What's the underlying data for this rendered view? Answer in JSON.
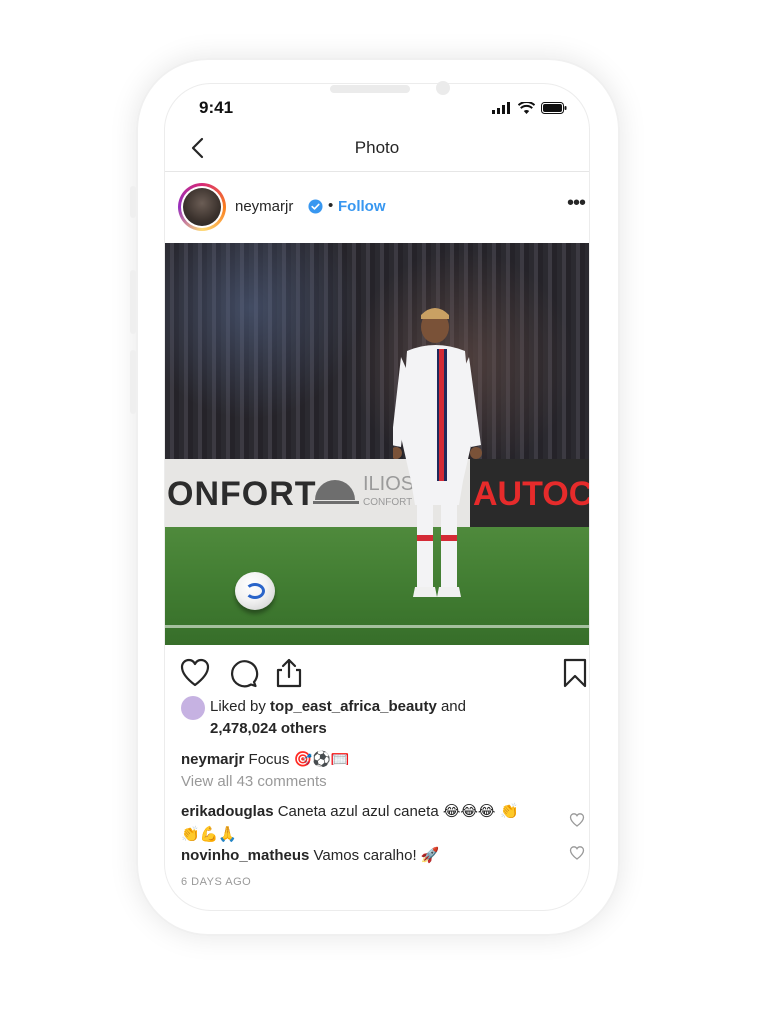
{
  "status_bar": {
    "time": "9:41"
  },
  "nav": {
    "title": "Photo"
  },
  "post": {
    "username": "neymarjr",
    "separator": "•",
    "follow_label": "Follow",
    "more_label": "•••"
  },
  "photo": {
    "ad_left": "ONFORT",
    "ad_mid": "ILIOS",
    "ad_mid_sub": "CONFORT",
    "ad_right": "AUTOC"
  },
  "likes": {
    "prefix": "Liked by ",
    "liker": "top_east_africa_beauty",
    "and": " and",
    "others": "2,478,024 others"
  },
  "caption": {
    "username": "neymarjr",
    "text": " Focus ",
    "emoji": "🎯⚽🥅"
  },
  "view_all": "View all 43 comments",
  "comments": [
    {
      "username": "erikadouglas",
      "text": " Caneta azul azul caneta ",
      "emoji": "😂😂😂 👏",
      "emoji_line2": "👏💪🙏"
    },
    {
      "username": "novinho_matheus",
      "text": " Vamos caralho! ",
      "emoji": "🚀"
    }
  ],
  "timestamp": "6 DAYS AGO",
  "colors": {
    "link_blue": "#3897f0",
    "text": "#262626",
    "muted": "#999999"
  }
}
